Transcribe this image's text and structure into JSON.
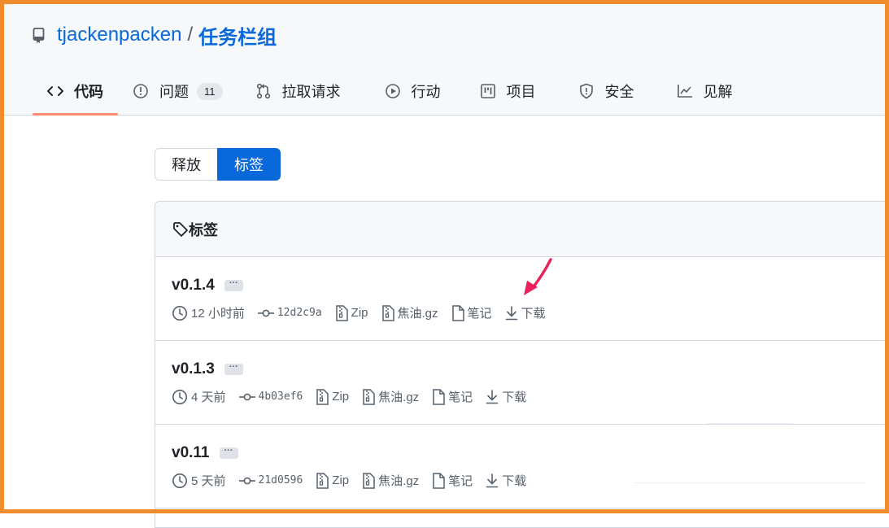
{
  "repo": {
    "owner": "tjackenpacken",
    "separator": "/",
    "name": "任务栏组"
  },
  "tabs": [
    {
      "label": "代码",
      "icon": "code-icon",
      "active": true
    },
    {
      "label": "问题",
      "icon": "issue-icon",
      "count": "11"
    },
    {
      "label": "拉取请求",
      "icon": "pull-request-icon"
    },
    {
      "label": "行动",
      "icon": "play-icon"
    },
    {
      "label": "项目",
      "icon": "project-icon"
    },
    {
      "label": "安全",
      "icon": "shield-icon"
    },
    {
      "label": "见解",
      "icon": "graph-icon"
    }
  ],
  "toggle": {
    "releases": "释放",
    "tags": "标签",
    "selected": "标签"
  },
  "tags_panel": {
    "title": "标签",
    "ellipsis": "···",
    "items": [
      {
        "version": "v0.1.4",
        "time": "12 小时前",
        "commit": "12d2c9a",
        "zip": "Zip",
        "targz": "焦油.gz",
        "notes": "笔记",
        "download": "下载"
      },
      {
        "version": "v0.1.3",
        "time": "4 天前",
        "commit": "4b03ef6",
        "zip": "Zip",
        "targz": "焦油.gz",
        "notes": "笔记",
        "download": "下载"
      },
      {
        "version": "v0.11",
        "time": "5 天前",
        "commit": "21d0596",
        "zip": "Zip",
        "targz": "焦油.gz",
        "notes": "笔记",
        "download": "下载"
      }
    ]
  },
  "colors": {
    "accent": "#0969da",
    "tab_underline": "#fd8c73",
    "annotation_arrow": "#e8215a",
    "frame": "#f08c2c"
  }
}
